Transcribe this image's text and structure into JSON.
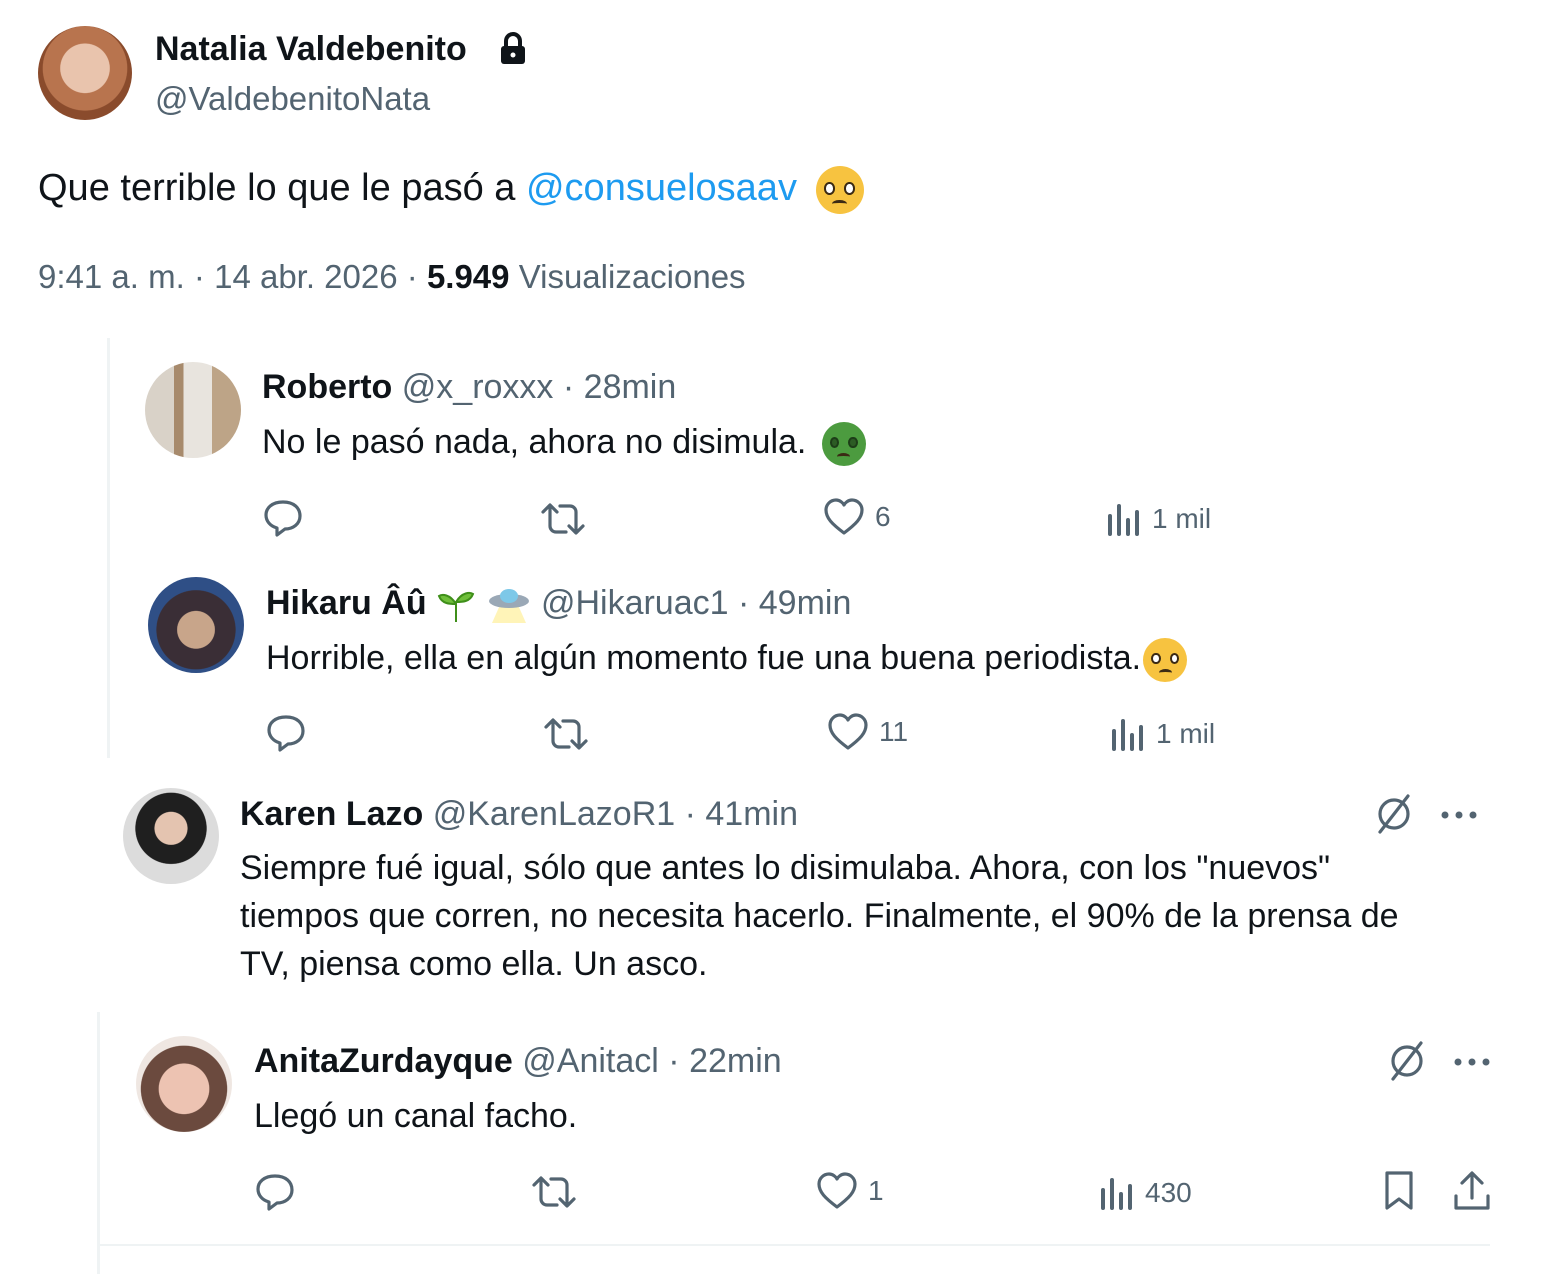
{
  "main_post": {
    "author_name": "Natalia Valdebenito",
    "lock_icon": "lock-icon",
    "handle": "@ValdebenitoNata",
    "text_before": "Que terrible lo que le pasó a ",
    "mention": "@consuelosaav",
    "emoji": "pleading-face-emoji",
    "time": "9:41 a. m.",
    "separator": "·",
    "date": "14 abr. 2026",
    "views_count": "5.949",
    "views_label": "Visualizaciones"
  },
  "replies": [
    {
      "name": "Roberto",
      "handle": "@x_roxxx",
      "time": "· 28min",
      "text": "No le pasó nada, ahora no disimula.",
      "emoji": "nauseated-face-emoji",
      "likes": "6",
      "views": "1 mil"
    },
    {
      "name": "Hikaru Âû",
      "name_emojis": "seedling-emoji ufo-emoji",
      "handle": "@Hikaruac1",
      "time": "· 49min",
      "text": "Horrible, ella en algún momento fue una buena periodista.",
      "emoji": "pleading-face-emoji",
      "likes": "11",
      "views": "1 mil"
    },
    {
      "name": "Karen Lazo",
      "handle": "@KarenLazoR1",
      "time": "· 41min",
      "text_line1": "Siempre fué igual, sólo que antes lo disimulaba. Ahora, con los \"nuevos\"",
      "text_line2": "tiempos que corren, no necesita hacerlo. Finalmente, el 90% de la prensa de",
      "text_line3": "TV, piensa como ella. Un asco.",
      "more_icon": "more-horizontal-icon",
      "grok_icon": "grok-icon"
    },
    {
      "name": "AnitaZurdayque",
      "handle": "@Anitacl",
      "time": "· 22min",
      "text": "Llegó un canal facho.",
      "likes": "1",
      "views": "430",
      "more_icon": "more-horizontal-icon",
      "grok_icon": "grok-icon"
    }
  ],
  "colors": {
    "link": "#1d9bf0",
    "muted": "#536471",
    "text": "#0f1419"
  }
}
